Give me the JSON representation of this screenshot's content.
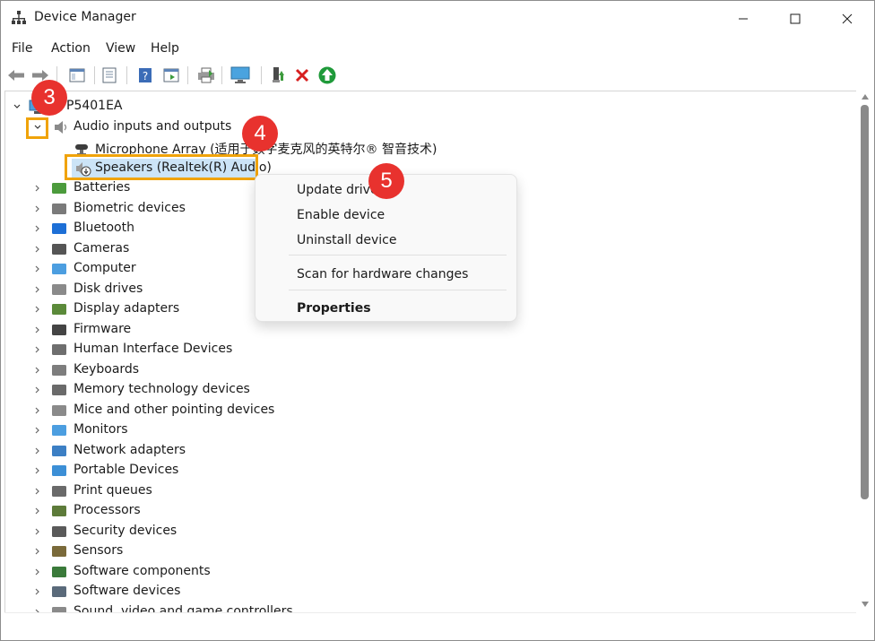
{
  "window": {
    "title": "Device Manager"
  },
  "menu": [
    "File",
    "Action",
    "View",
    "Help"
  ],
  "tree": {
    "computer": "P5401EA",
    "audio": "Audio inputs and outputs",
    "mic": "Microphone Array (适用于数字麦克风的英特尔® 智音技术)",
    "speakers": "Speakers (Realtek(R) Audio)",
    "categories": [
      "Batteries",
      "Biometric devices",
      "Bluetooth",
      "Cameras",
      "Computer",
      "Disk drives",
      "Display adapters",
      "Firmware",
      "Human Interface Devices",
      "Keyboards",
      "Memory technology devices",
      "Mice and other pointing devices",
      "Monitors",
      "Network adapters",
      "Portable Devices",
      "Print queues",
      "Processors",
      "Security devices",
      "Sensors",
      "Software components",
      "Software devices",
      "Sound, video and game controllers"
    ]
  },
  "context_menu": {
    "update": "Update driver",
    "enable": "Enable device",
    "uninstall": "Uninstall device",
    "scan": "Scan for hardware changes",
    "properties": "Properties"
  },
  "badges": [
    "3",
    "4",
    "5"
  ],
  "colors": {
    "highlight": "#f0a30a",
    "badge": "#e8322e",
    "selection": "#cce4f7"
  }
}
